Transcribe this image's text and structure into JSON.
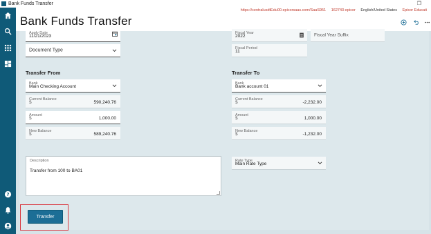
{
  "window": {
    "title": "Bank Funds Transfer",
    "restore_glyph": "❐"
  },
  "header": {
    "title": "Bank Funds Transfer",
    "url": "https://centralusdtEdu00.epicorsaas.com/SaaS951",
    "company": "162743-epicor",
    "locale": "English/United States",
    "product": "Epicor Educati"
  },
  "sidebar": {
    "items": [
      "home-icon",
      "search-icon",
      "apps-icon",
      "dashboard-icon",
      "help-icon",
      "notifications-icon",
      "user-icon"
    ]
  },
  "form": {
    "apply_date": {
      "label": "Apply Date",
      "value": "11/21/2023"
    },
    "document_type": {
      "placeholder": "Document Type"
    },
    "fiscal_year": {
      "label": "Fiscal Year",
      "value": "2022"
    },
    "fiscal_year_suffix": {
      "placeholder": "Fiscal Year Suffix"
    },
    "fiscal_period": {
      "label": "Fiscal Period",
      "value": "11"
    },
    "transfer_from": {
      "title": "Transfer From",
      "bank": {
        "label": "Bank",
        "value": "Main Checking Account"
      },
      "current_balance": {
        "label": "Current Balance",
        "currency": "$",
        "value": "590,240.76"
      },
      "amount": {
        "label": "Amount",
        "currency": "$",
        "value": "1,000.00"
      },
      "new_balance": {
        "label": "New Balance",
        "currency": "$",
        "value": "589,240.76"
      }
    },
    "transfer_to": {
      "title": "Transfer To",
      "bank": {
        "label": "Bank",
        "value": "Bank account 01"
      },
      "current_balance": {
        "label": "Current Balance",
        "currency": "$",
        "value": "-2,232.00"
      },
      "amount": {
        "label": "Amount",
        "currency": "$",
        "value": "1,000.00"
      },
      "new_balance": {
        "label": "New Balance",
        "currency": "$",
        "value": "-1,232.00"
      }
    },
    "description": {
      "label": "Description",
      "value": "Transfer from 100 to BA01"
    },
    "rate_type": {
      "label": "Rate Type",
      "value": "Main Rate Type"
    }
  },
  "actions": {
    "transfer_label": "Transfer"
  },
  "colors": {
    "nav": "#0f5a78",
    "accent": "#1c6e96",
    "highlight": "#d9363e",
    "panel": "#dde8ec"
  }
}
